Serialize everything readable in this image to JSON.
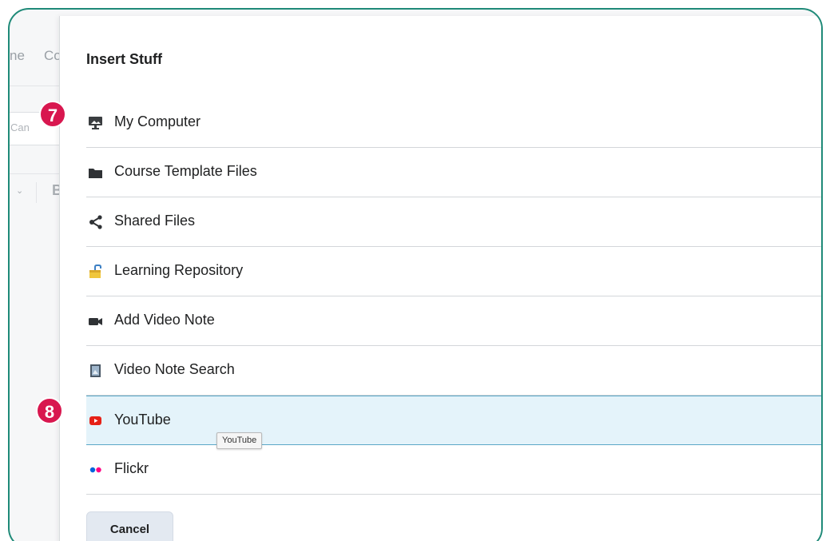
{
  "background": {
    "nav_a": "ne",
    "nav_b": "Co",
    "input_placeholder": "Can",
    "toolbar_chevron": "⌄",
    "toolbar_bold": "B"
  },
  "dialog": {
    "title": "Insert Stuff",
    "items": [
      {
        "label": "My Computer",
        "icon": "computer-icon"
      },
      {
        "label": "Course Template Files",
        "icon": "folder-icon"
      },
      {
        "label": "Shared Files",
        "icon": "share-icon"
      },
      {
        "label": "Learning Repository",
        "icon": "repository-icon"
      },
      {
        "label": "Add Video Note",
        "icon": "video-camera-icon"
      },
      {
        "label": "Video Note Search",
        "icon": "video-note-search-icon"
      },
      {
        "label": "YouTube",
        "icon": "youtube-icon",
        "selected": true
      },
      {
        "label": "Flickr",
        "icon": "flickr-icon"
      }
    ],
    "cancel_label": "Cancel"
  },
  "tooltip": "YouTube",
  "callouts": {
    "seven": "7",
    "eight": "8"
  },
  "colors": {
    "frame_border": "#1f8a78",
    "callout": "#d8174f",
    "selected_bg": "#e4f3fa",
    "selected_border": "#5aa7c7",
    "youtube_red": "#e62117",
    "flickr_blue": "#0063dc",
    "flickr_pink": "#ff0084"
  }
}
